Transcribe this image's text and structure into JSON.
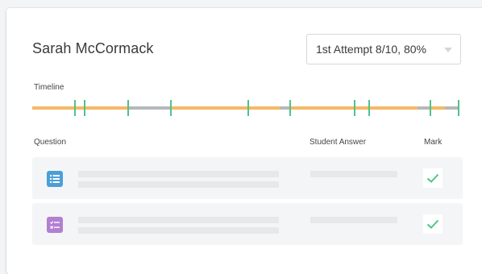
{
  "student": {
    "name": "Sarah McCormack"
  },
  "attempt_select": {
    "selected": "1st Attempt 8/10, 80%"
  },
  "timeline": {
    "label": "Timeline",
    "colors": {
      "active": "#f5b965",
      "idle": "#b5b8bb",
      "tick": "#4fc38a"
    },
    "segments": [
      {
        "state": "active",
        "start": 0,
        "end": 0.224
      },
      {
        "state": "idle",
        "start": 0.224,
        "end": 0.325
      },
      {
        "state": "active",
        "start": 0.325,
        "end": 0.58
      },
      {
        "state": "idle",
        "start": 0.58,
        "end": 0.603
      },
      {
        "state": "active",
        "start": 0.603,
        "end": 0.902
      },
      {
        "state": "idle",
        "start": 0.902,
        "end": 0.932
      },
      {
        "state": "active",
        "start": 0.932,
        "end": 0.966
      },
      {
        "state": "idle",
        "start": 0.966,
        "end": 1.0
      }
    ],
    "markers": [
      0.1,
      0.122,
      0.224,
      0.325,
      0.506,
      0.603,
      0.754,
      0.789,
      0.932,
      1.0
    ]
  },
  "table": {
    "headers": {
      "question": "Question",
      "answer": "Student Answer",
      "mark": "Mark"
    },
    "rows": [
      {
        "icon": "list-icon",
        "icon_color": "#4a9fd8",
        "mark": "check-icon"
      },
      {
        "icon": "checklist-icon",
        "icon_color": "#b27fd1",
        "mark": "check-icon"
      }
    ],
    "check_color": "#4fc38a"
  }
}
